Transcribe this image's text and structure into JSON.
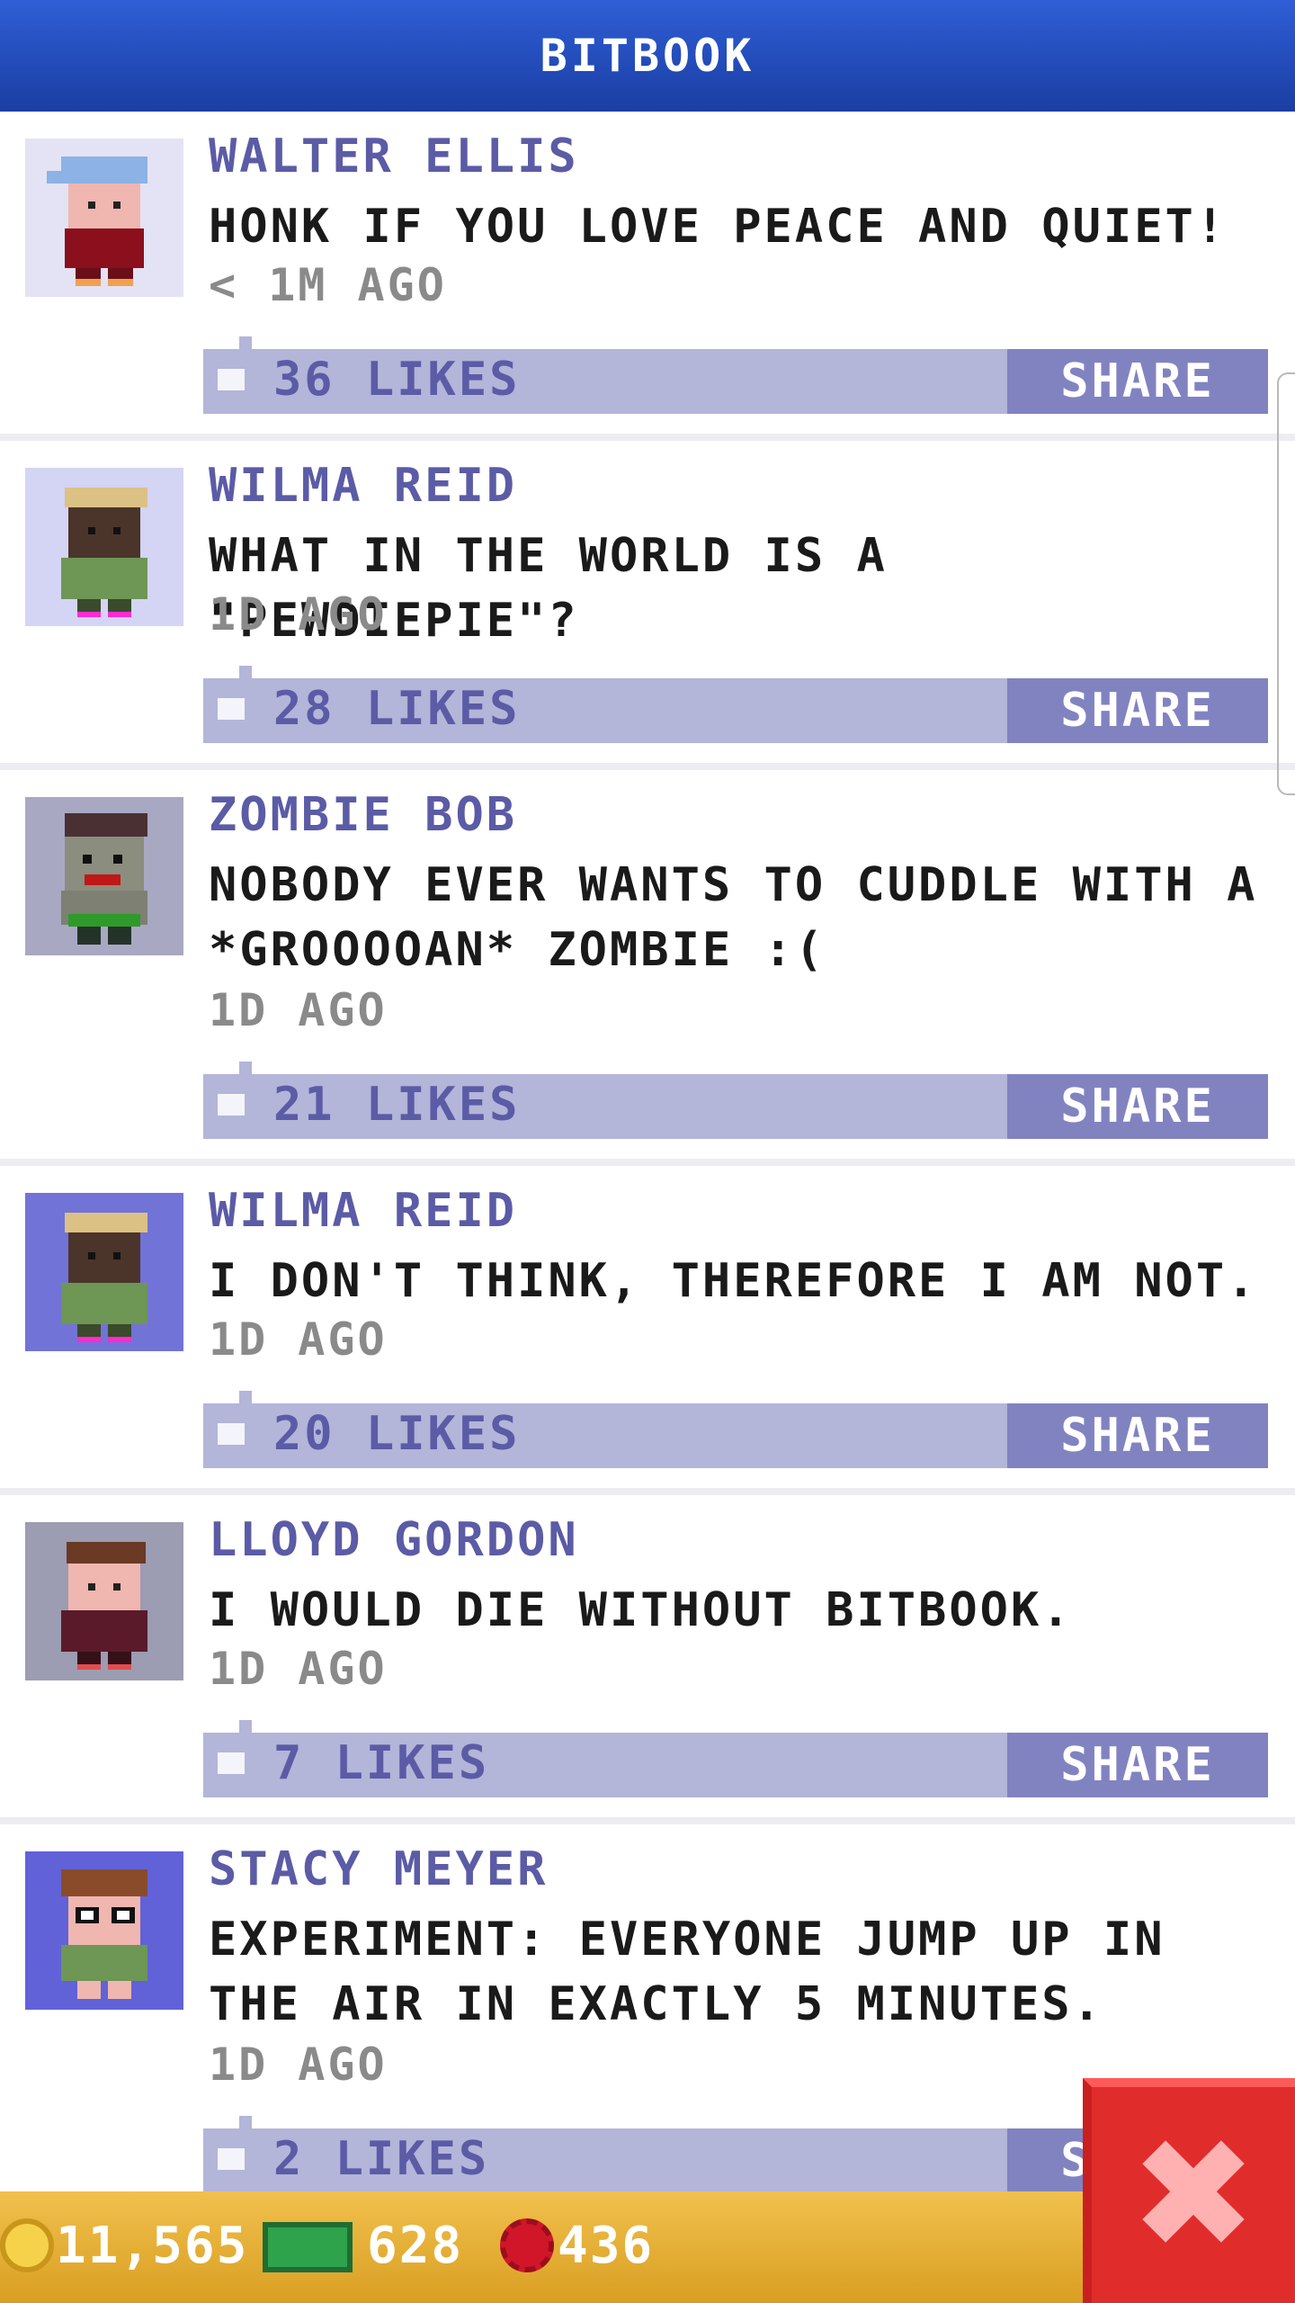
{
  "header": {
    "title": "BITBOOK"
  },
  "posts": [
    {
      "author": "WALTER ELLIS",
      "message": "HONK IF YOU LOVE PEACE AND QUIET!",
      "time": "< 1M AGO",
      "likes": "36 LIKES",
      "share": "SHARE",
      "avatar_bg": "#e3e3f5"
    },
    {
      "author": "WILMA REID",
      "message": "WHAT IN THE WORLD IS A \"PEWDIEPIE\"?",
      "time": "1D AGO",
      "likes": "28 LIKES",
      "share": "SHARE",
      "avatar_bg": "#d4d4f4"
    },
    {
      "author": "ZOMBIE BOB",
      "message": "NOBODY EVER WANTS TO CUDDLE WITH A *GROOOOAN* ZOMBIE :(",
      "time": "1D AGO",
      "likes": "21 LIKES",
      "share": "SHARE",
      "avatar_bg": "#a8a8c3"
    },
    {
      "author": "WILMA REID",
      "message": "I DON'T THINK, THEREFORE I AM NOT.",
      "time": "1D AGO",
      "likes": "20 LIKES",
      "share": "SHARE",
      "avatar_bg": "#7273d6"
    },
    {
      "author": "LLOYD GORDON",
      "message": "I WOULD DIE WITHOUT BITBOOK.",
      "time": "1D AGO",
      "likes": "7 LIKES",
      "share": "SHARE",
      "avatar_bg": "#9c9cb2"
    },
    {
      "author": "STACY MEYER",
      "message": "EXPERIMENT: EVERYONE JUMP UP IN THE AIR IN EXACTLY 5 MINUTES.",
      "time": "1D AGO",
      "likes": "2 LIKES",
      "share": "SHARE",
      "avatar_bg": "#6162d8"
    }
  ],
  "footer": {
    "coins": "11,565",
    "cash": "628",
    "gems": "436"
  },
  "close_button": {
    "icon": "close-icon"
  }
}
